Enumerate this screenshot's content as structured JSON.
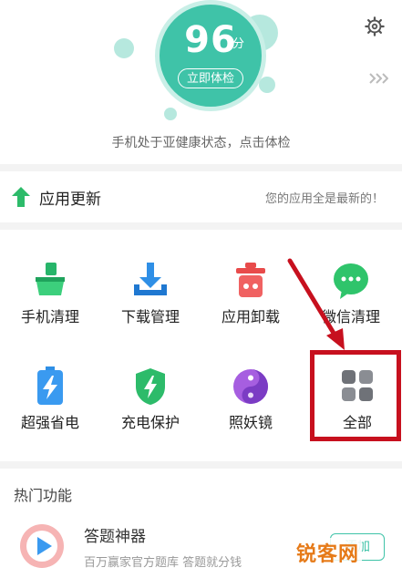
{
  "header": {
    "score": "96",
    "score_unit": "分",
    "check_button": "立即体检",
    "status_text": "手机处于亚健康状态，点击体检",
    "settings_icon": "gear-icon",
    "more_icon": "double-chevron-right-icon"
  },
  "update": {
    "label": "应用更新",
    "status": "您的应用全是最新的！",
    "icon": "arrow-up-icon"
  },
  "tools": [
    {
      "label": "手机清理",
      "icon": "broom-icon"
    },
    {
      "label": "下载管理",
      "icon": "download-icon"
    },
    {
      "label": "应用卸载",
      "icon": "trash-icon"
    },
    {
      "label": "微信清理",
      "icon": "wechat-icon"
    },
    {
      "label": "超强省电",
      "icon": "battery-icon"
    },
    {
      "label": "充电保护",
      "icon": "shield-bolt-icon"
    },
    {
      "label": "照妖镜",
      "icon": "yin-yang-icon"
    },
    {
      "label": "全部",
      "icon": "grid-icon"
    }
  ],
  "hot": {
    "title": "热门功能",
    "items": [
      {
        "name": "答题神器",
        "desc": "百万赢家官方题库 答题就分钱",
        "button": "添加",
        "icon": "play-icon"
      }
    ]
  },
  "watermark": "锐客网",
  "colors": {
    "accent": "#3fc3a8",
    "highlight": "#c7101e",
    "green": "#2dbb6a"
  }
}
